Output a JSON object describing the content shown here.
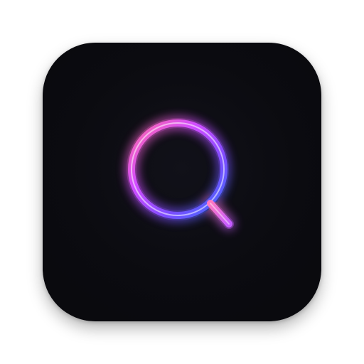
{
  "icon": {
    "name": "search-app-icon",
    "glyph": "magnifying-glass",
    "background_color": "#0b0b10",
    "gradient_colors": [
      "#ff5fa0",
      "#c24dff",
      "#6a4dff",
      "#3d6bff"
    ]
  }
}
